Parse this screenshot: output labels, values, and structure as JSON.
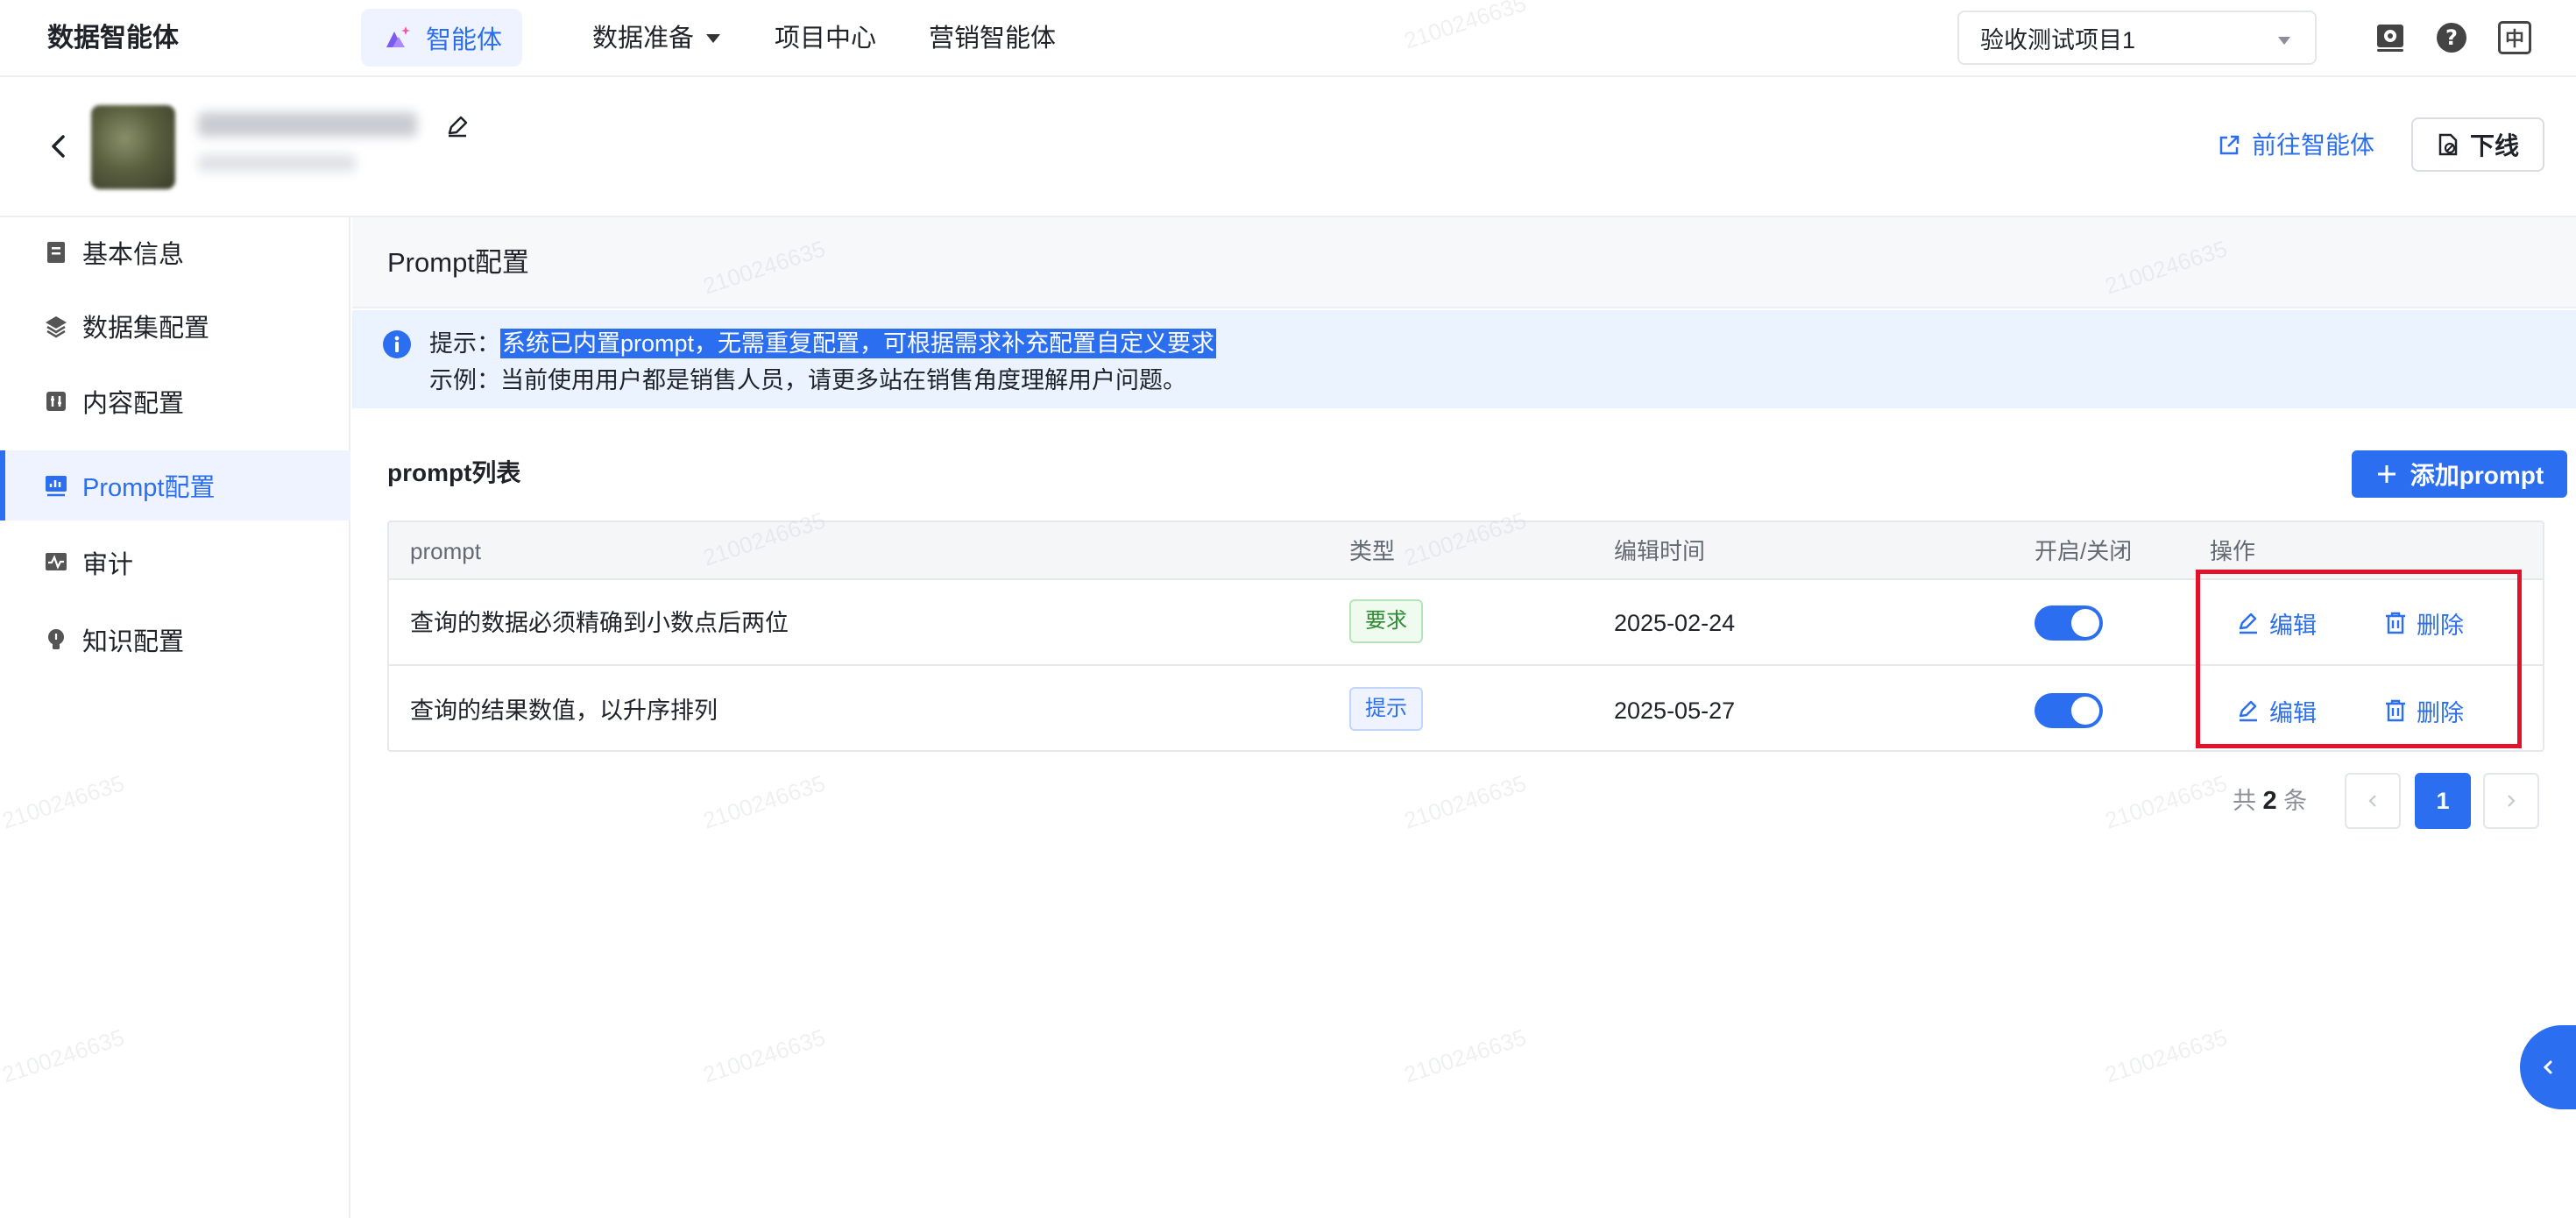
{
  "topnav": {
    "brand": "数据智能体",
    "items": [
      {
        "label": "智能体",
        "active": true
      },
      {
        "label": "数据准备",
        "dropdown": true
      },
      {
        "label": "项目中心"
      },
      {
        "label": "营销智能体"
      }
    ],
    "project_select": "验收测试项目1",
    "icons": [
      "settings-icon",
      "help-icon",
      "language-icon"
    ],
    "language_label": "中"
  },
  "header": {
    "goto_agent_label": "前往智能体",
    "offline_label": "下线"
  },
  "sidebar": {
    "items": [
      {
        "label": "基本信息",
        "icon": "document-icon"
      },
      {
        "label": "数据集配置",
        "icon": "layers-icon"
      },
      {
        "label": "内容配置",
        "icon": "content-icon"
      },
      {
        "label": "Prompt配置",
        "icon": "chart-board-icon",
        "active": true
      },
      {
        "label": "审计",
        "icon": "pulse-icon"
      },
      {
        "label": "知识配置",
        "icon": "bulb-icon"
      }
    ]
  },
  "main": {
    "section_title": "Prompt配置",
    "tip": {
      "prefix": "提示：",
      "highlight": "系统已内置prompt，无需重复配置，可根据需求补充配置自定义要求",
      "example": "示例：当前使用用户都是销售人员，请更多站在销售角度理解用户问题。"
    },
    "list_title": "prompt列表",
    "add_button": "添加prompt",
    "table": {
      "headers": [
        "prompt",
        "类型",
        "编辑时间",
        "开启/关闭",
        "操作"
      ],
      "rows": [
        {
          "prompt": "查询的数据必须精确到小数点后两位",
          "type": "要求",
          "time": "2025-02-24",
          "enabled": true,
          "edit": "编辑",
          "delete": "删除"
        },
        {
          "prompt": "查询的结果数值，以升序排列",
          "type": "提示",
          "time": "2025-05-27",
          "enabled": true,
          "edit": "编辑",
          "delete": "删除"
        }
      ]
    },
    "pagination": {
      "total_prefix": "共",
      "total": "2",
      "total_suffix": "条",
      "current_page": "1"
    }
  },
  "watermark": "2100246635",
  "colors": {
    "accent": "#2b6ff0",
    "highlight_box": "#e3122a",
    "tag_green": "#2e8a33"
  }
}
